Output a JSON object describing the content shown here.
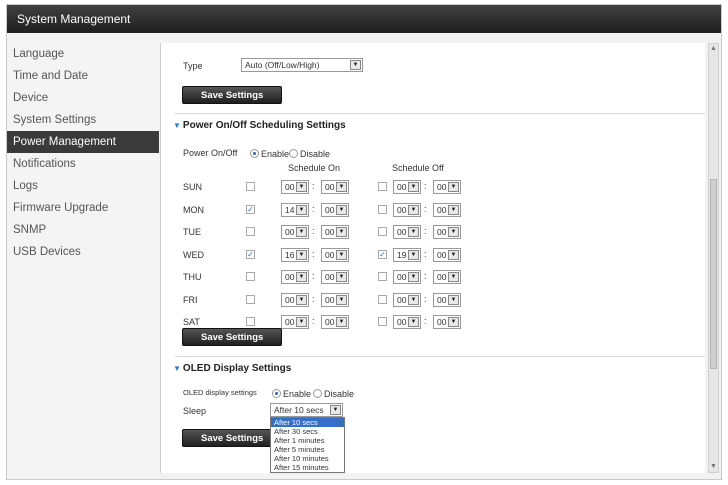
{
  "window": {
    "title": "System Management"
  },
  "sidebar": {
    "items": [
      {
        "label": "Language",
        "active": false
      },
      {
        "label": "Time and Date",
        "active": false
      },
      {
        "label": "Device",
        "active": false
      },
      {
        "label": "System Settings",
        "active": false
      },
      {
        "label": "Power Management",
        "active": true
      },
      {
        "label": "Notifications",
        "active": false
      },
      {
        "label": "Logs",
        "active": false
      },
      {
        "label": "Firmware Upgrade",
        "active": false
      },
      {
        "label": "SNMP",
        "active": false
      },
      {
        "label": "USB Devices",
        "active": false
      }
    ]
  },
  "fan": {
    "type_label": "Type",
    "type_value": "Auto (Off/Low/High)",
    "save_label": "Save Settings"
  },
  "schedule": {
    "title": "Power On/Off Scheduling Settings",
    "power_label": "Power On/Off",
    "enable_label": "Enable",
    "disable_label": "Disable",
    "enabled": true,
    "col_on": "Schedule On",
    "col_off": "Schedule Off",
    "days": [
      {
        "day": "SUN",
        "on_checked": false,
        "on_h": "00",
        "on_m": "00",
        "off_checked": false,
        "off_h": "00",
        "off_m": "00"
      },
      {
        "day": "MON",
        "on_checked": true,
        "on_h": "14",
        "on_m": "00",
        "off_checked": false,
        "off_h": "00",
        "off_m": "00"
      },
      {
        "day": "TUE",
        "on_checked": false,
        "on_h": "00",
        "on_m": "00",
        "off_checked": false,
        "off_h": "00",
        "off_m": "00"
      },
      {
        "day": "WED",
        "on_checked": true,
        "on_h": "16",
        "on_m": "00",
        "off_checked": true,
        "off_h": "19",
        "off_m": "00"
      },
      {
        "day": "THU",
        "on_checked": false,
        "on_h": "00",
        "on_m": "00",
        "off_checked": false,
        "off_h": "00",
        "off_m": "00"
      },
      {
        "day": "FRI",
        "on_checked": false,
        "on_h": "00",
        "on_m": "00",
        "off_checked": false,
        "off_h": "00",
        "off_m": "00"
      },
      {
        "day": "SAT",
        "on_checked": false,
        "on_h": "00",
        "on_m": "00",
        "off_checked": false,
        "off_h": "00",
        "off_m": "00"
      }
    ],
    "save_label": "Save Settings"
  },
  "oled": {
    "title": "OLED Display Settings",
    "display_label": "OLED display settings",
    "enable_label": "Enable",
    "disable_label": "Disable",
    "enabled": true,
    "sleep_label": "Sleep",
    "sleep_value": "After 10 secs",
    "sleep_options": [
      "After 10 secs",
      "After 30 secs",
      "After 1 minutes",
      "After 5 minutes",
      "After 10 minutes",
      "After 15 minutes"
    ],
    "save_label": "Save Settings"
  }
}
